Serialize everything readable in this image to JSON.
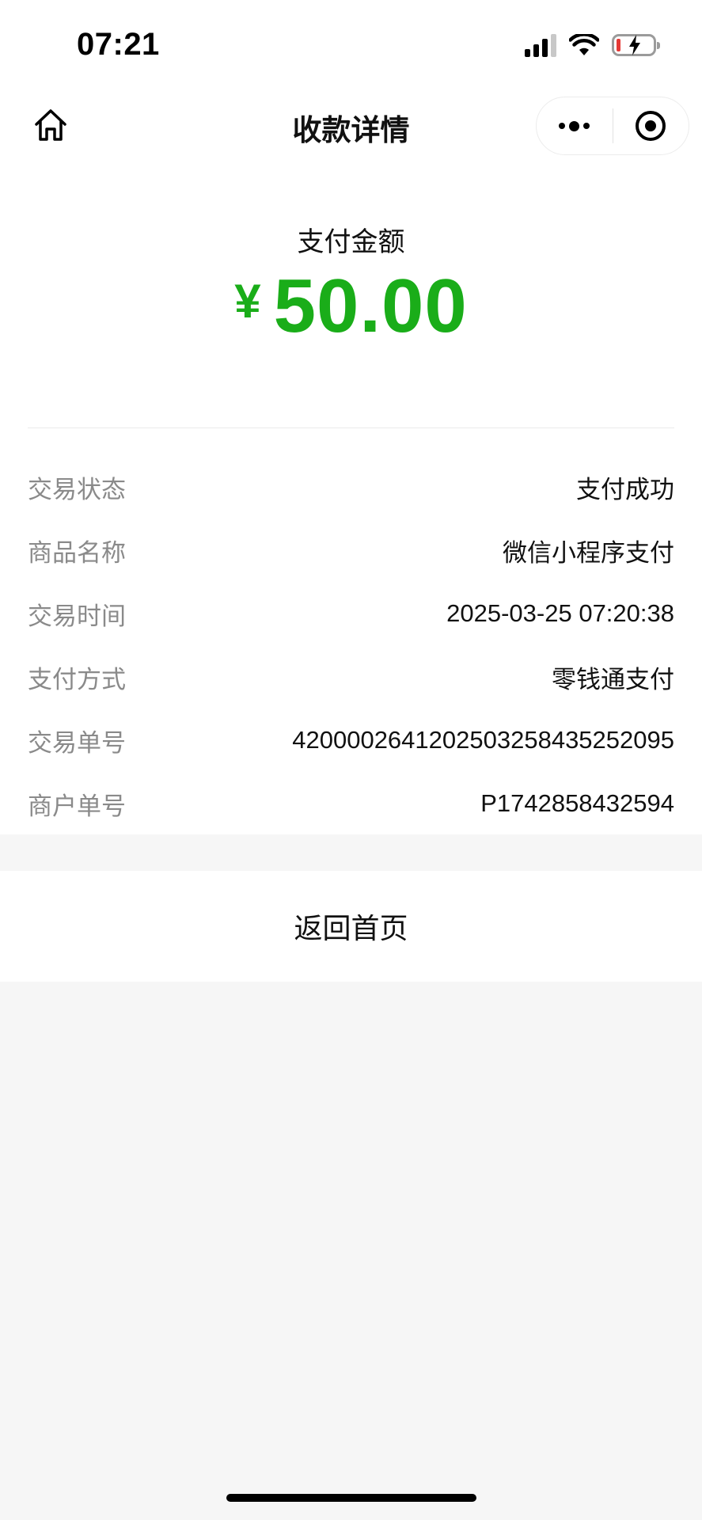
{
  "status_bar": {
    "time": "07:21"
  },
  "nav": {
    "title": "收款详情"
  },
  "payment": {
    "amount_label": "支付金额",
    "currency_symbol": "¥",
    "amount": "50.00",
    "amount_color": "#1aad19"
  },
  "details": [
    {
      "label": "交易状态",
      "value": "支付成功"
    },
    {
      "label": "商品名称",
      "value": "微信小程序支付"
    },
    {
      "label": "交易时间",
      "value": "2025-03-25 07:20:38"
    },
    {
      "label": "支付方式",
      "value": "零钱通支付"
    },
    {
      "label": "交易单号",
      "value": "4200002641202503258435252095"
    },
    {
      "label": "商户单号",
      "value": "P1742858432594"
    }
  ],
  "actions": {
    "back_home_label": "返回首页"
  },
  "icons": {
    "home": "home-icon",
    "more": "more-dots-icon",
    "close": "target-circle-icon",
    "signal": "cellular-signal-icon",
    "wifi": "wifi-icon",
    "battery": "battery-charging-icon"
  }
}
